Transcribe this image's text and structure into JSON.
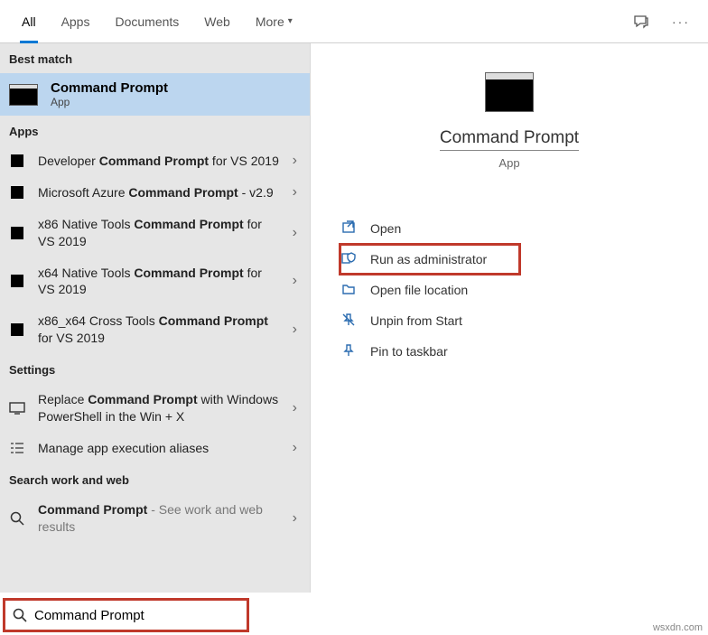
{
  "tabs": {
    "all": "All",
    "apps": "Apps",
    "documents": "Documents",
    "web": "Web",
    "more": "More"
  },
  "sections": {
    "best_match": "Best match",
    "apps": "Apps",
    "settings": "Settings",
    "search_web": "Search work and web"
  },
  "best_match": {
    "title": "Command Prompt",
    "type": "App"
  },
  "apps_list": [
    {
      "pre": "Developer ",
      "bold": "Command Prompt",
      "post": " for VS 2019"
    },
    {
      "pre": "Microsoft Azure ",
      "bold": "Command Prompt",
      "post": " - v2.9"
    },
    {
      "pre": "x86 Native Tools ",
      "bold": "Command Prompt",
      "post": " for VS 2019"
    },
    {
      "pre": "x64 Native Tools ",
      "bold": "Command Prompt",
      "post": " for VS 2019"
    },
    {
      "pre": "x86_x64 Cross Tools ",
      "bold": "Command Prompt",
      "post": " for VS 2019"
    }
  ],
  "settings_list": {
    "replace": {
      "pre": "Replace ",
      "bold": "Command Prompt",
      "post": " with Windows PowerShell in the Win + X"
    },
    "aliases": "Manage app execution aliases"
  },
  "web_list": {
    "cmd": {
      "bold": "Command Prompt",
      "hint": " - See work and web results"
    }
  },
  "preview": {
    "title": "Command Prompt",
    "type": "App"
  },
  "actions": {
    "open": "Open",
    "run_admin": "Run as administrator",
    "open_loc": "Open file location",
    "unpin": "Unpin from Start",
    "pin": "Pin to taskbar"
  },
  "search": {
    "value": "Command Prompt"
  },
  "watermark": "wsxdn.com"
}
